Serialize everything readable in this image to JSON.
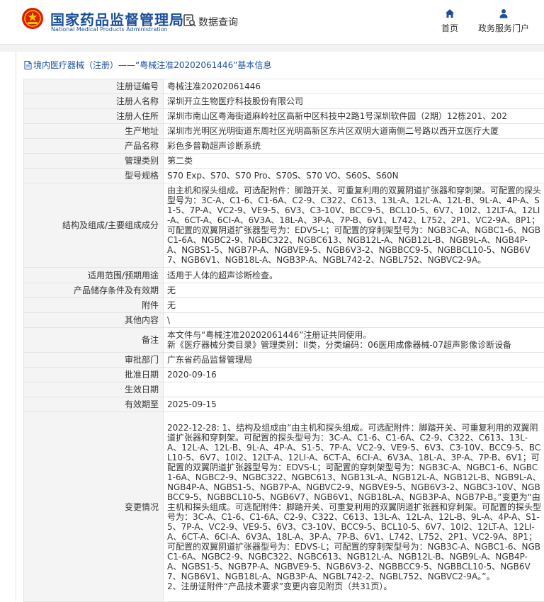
{
  "header": {
    "org_name_cn": "国家药品监督管理局",
    "org_name_en": "National Medical Products Administration",
    "query_label": "数据查询",
    "nav": [
      {
        "label": "首页",
        "icon": "home-icon"
      },
      {
        "label": "政务服务门户",
        "icon": "user-icon"
      }
    ]
  },
  "breadcrumb": "境内医疗器械（注册）——“粤械注准20202061446”基本信息",
  "rows": [
    {
      "label": "注册证编号",
      "value": "粤械注准20202061446"
    },
    {
      "label": "注册人名称",
      "value": "深圳开立生物医疗科技股份有限公司"
    },
    {
      "label": "注册人住所",
      "value": "深圳市南山区粤海街道麻岭社区高新中区科技中2路1号深圳软件园（2期）12栋201、202"
    },
    {
      "label": "生产地址",
      "value": "深圳市光明区光明街道东周社区光明高新区东片区双明大道南侧二号路以西开立医疗大厦"
    },
    {
      "label": "产品名称",
      "value": "彩色多普勒超声诊断系统"
    },
    {
      "label": "管理类别",
      "value": "第二类"
    },
    {
      "label": "型号规格",
      "value": "S70 Exp、S70、S70 Pro、S70S、S70 VO、S60S、S60N"
    },
    {
      "label": "结构及组成/主要组成成分",
      "value": "由主机和探头组成。可选配附件：脚踏开关、可重复利用的双翼阴道扩张器和穿刺架。可配置的探头型号为：3C-A、C1-6、C1-6A、C2-9、C322、C613、13L-A、12L-A、12L-B、9L-A、4P-A、S1-5、7P-A、VC2-9、VE9-5、6V3、C3-10V、BCC9-5、BCL10-5、6V7、10I2、12LT-A、12LI-A、6CT-A、6CI-A、6V3A、18L-A、3P-A、7P-B、6V1、L742、L752、2P1、VC2-9A、8P1；可配置的双翼阴道扩张器型号为：EDVS-L；可配置的穿刺架型号为：NGB3C-A、NGBC1-6、NGBC1-6A、NGBC2-9、NGBC322、NGBC613、NGB12L-A、NGB12L-B、NGB9L-A、NGB4P-A、NGBS1-5、NGB7P-A、NGBVE9-5、NGB6V3-2、NGBBCC9-5、NGBBCL10-5、NGB6V7、NGB6V1、NGB18L-A、NGB3P-A、NGBL742-2、NGBL752、NGBVC2-9A。"
    },
    {
      "label": "适用范围/预期用途",
      "value": "适用于人体的超声诊断检查。"
    },
    {
      "label": "产品储存条件及有效期",
      "value": "无"
    },
    {
      "label": "附件",
      "value": "无"
    },
    {
      "label": "其他内容",
      "value": "\\"
    },
    {
      "label": "备注",
      "value": "本文件与“粤械注准20202061446”注册证共同使用。\n新《医疗器械分类目录》管理类别：II类，分类编码：06医用成像器械-07超声影像诊断设备"
    },
    {
      "label": "审批部门",
      "value": "广东省药品监督管理局"
    },
    {
      "label": "批准日期",
      "value": "2020-09-16"
    },
    {
      "label": "生效日期",
      "value": ""
    },
    {
      "label": "有效期至",
      "value": "2025-09-15"
    },
    {
      "label": "变更情况",
      "value": "2022-12-28: 1、结构及组成由“由主机和探头组成。可选配附件：脚踏开关、可重复利用的双翼阴道扩张器和穿刺架。可配置的探头型号为：3C-A、C1-6、C1-6A、C2-9、C322、C613、13L-A、12L-A、12L-B、9L-A、4P-A、S1-5、7P-A、VC2-9、VE9-5、6V3、C3-10V、BCC9-5、BCL10-5、6V7、10I2、12LT-A、12LI-A、6CT-A、6CI-A、6V3A、18L-A、3P-A、7P-B、6V1；可配置的双翼阴道扩张器型号为：EDVS-L；可配置的穿刺架型号为：NGB3C-A、NGBC1-6、NGBC1-6A、NGBC2-9、NGBC322、NGBC613、NGB13L-A、NGB12L-A、NGB12L-B、NGB9L-A、NGB4P-A、NGBS1-5、NGB7P-A、NGBVC2-9、NGBVE9-5、NGB6V3-2、NGBC3-10V、NGBBCC9-5、NGBBCL10-5、NGB6V7、NGB6V1、NGB18L-A、NGB3P-A、NGB7P-B。”变更为“由主机和探头组成。可选配附件：脚踏开关、可重复利用的双翼阴道扩张器和穿刺架。可配置的探头型号为：3C-A、C1-6、C1-6A、C2-9、C322、C613、13L-A、12L-A、12L-B、9L-A、4P-A、S1-5、7P-A、VC2-9、VE9-5、6V3、C3-10V、BCC9-5、BCL10-5、6V7、10I2、12LT-A、12LI-A、6CT-A、6CI-A、6V3A、18L-A、3P-A、7P-B、6V1、L742、L752、2P1、VC2-9A、8P1；可配置的双翼阴道扩张器型号为：EDVS-L；可配置的穿刺架型号为：NGB3C-A、NGBC1-6、NGBC1-6A、NGBC2-9、NGBC322、NGBC613、NGB12L-A、NGB12L-B、NGB9L-A、NGB4P-A、NGBS1-5、NGB7P-A、NGBVE9-5、NGB6V3-2、NGBBCC9-5、NGBBCL10-5、NGB6V7、NGB6V1、NGB18L-A、NGB3P-A、NGBL742-2、NGBL752、NGBVC2-9A。”。\n2、注册证附件“产品技术要求”变更内容见附页（共31页）。"
    }
  ]
}
